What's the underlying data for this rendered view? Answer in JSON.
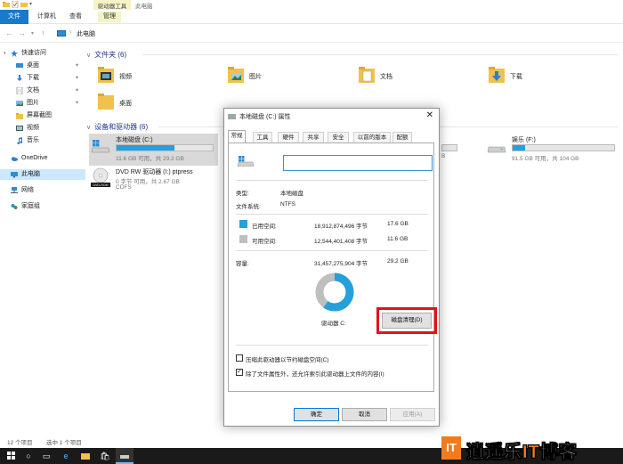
{
  "ribbon": {
    "tabs": [
      "文件",
      "计算机",
      "查看",
      "管理"
    ],
    "drive_tools": "驱动器工具",
    "window_title": "此电脑"
  },
  "address": {
    "path": "此电脑"
  },
  "nav": {
    "items": [
      {
        "label": "快速访问",
        "icon": "star-icon"
      },
      {
        "label": "桌面",
        "icon": "desktop-icon"
      },
      {
        "label": "下载",
        "icon": "download-icon"
      },
      {
        "label": "文档",
        "icon": "document-icon"
      },
      {
        "label": "图片",
        "icon": "picture-icon"
      },
      {
        "label": "屏幕截图",
        "icon": "folder-icon"
      },
      {
        "label": "视频",
        "icon": "video-icon"
      },
      {
        "label": "音乐",
        "icon": "music-icon"
      },
      {
        "label": "OneDrive",
        "icon": "cloud-icon"
      },
      {
        "label": "此电脑",
        "icon": "pc-icon"
      },
      {
        "label": "网络",
        "icon": "network-icon"
      },
      {
        "label": "家庭组",
        "icon": "homegroup-icon"
      }
    ]
  },
  "content": {
    "folders_header": "文件夹 (6)",
    "folders": [
      "视频",
      "图片",
      "文档",
      "下载",
      "桌面"
    ],
    "devices_header": "设备和驱动器 (6)",
    "drives": [
      {
        "name": "本地磁盘 (C:)",
        "free": "11.6 GB 可用，共 29.2 GB",
        "used_fraction": 0.6
      },
      {
        "name": "DVD RW 驱动器 (I:) ptpress",
        "free": "0 字节 可用，共 2.67 GB",
        "fs": "CDFS"
      },
      {
        "name": "娱乐 (F:)",
        "free": "91.5 GB 可用，共 104 GB",
        "used_fraction": 0.12
      }
    ],
    "partial_drive_free": "B"
  },
  "status": {
    "count": "12 个项目",
    "selected": "选中 1 个项目"
  },
  "dialog": {
    "title": "本地磁盘 (C:) 属性",
    "tabs": [
      "常规",
      "工具",
      "硬件",
      "共享",
      "安全",
      "以前的版本",
      "配额"
    ],
    "name_value": "",
    "type_label": "类型:",
    "type_value": "本地磁盘",
    "fs_label": "文件系统:",
    "fs_value": "NTFS",
    "used_label": "已用空间:",
    "used_bytes": "18,912,874,496 字节",
    "used_gb": "17.6 GB",
    "free_label": "可用空间:",
    "free_bytes": "12,544,401,408 字节",
    "free_gb": "11.6 GB",
    "cap_label": "容量:",
    "cap_bytes": "31,457,275,904 字节",
    "cap_gb": "29.2 GB",
    "drive_label": "驱动器 C:",
    "cleanup": "磁盘清理(D)",
    "compress": "压缩此驱动器以节约磁盘空间(C)",
    "index": "除了文件属性外，还允许索引此驱动器上文件的内容(I)",
    "ok": "确定",
    "cancel": "取消",
    "apply": "应用(A)",
    "used_fraction": 0.6,
    "used_color": "#26a0da",
    "free_color": "#bfbfbf"
  },
  "brand": {
    "logo": "IT",
    "text_a": "逍遥乐",
    "text_hl": "IT",
    "text_b": "博客"
  },
  "colors": {
    "accent": "#1979ca",
    "highlight": "#e2121b",
    "brand_orange": "#f07c1f"
  }
}
